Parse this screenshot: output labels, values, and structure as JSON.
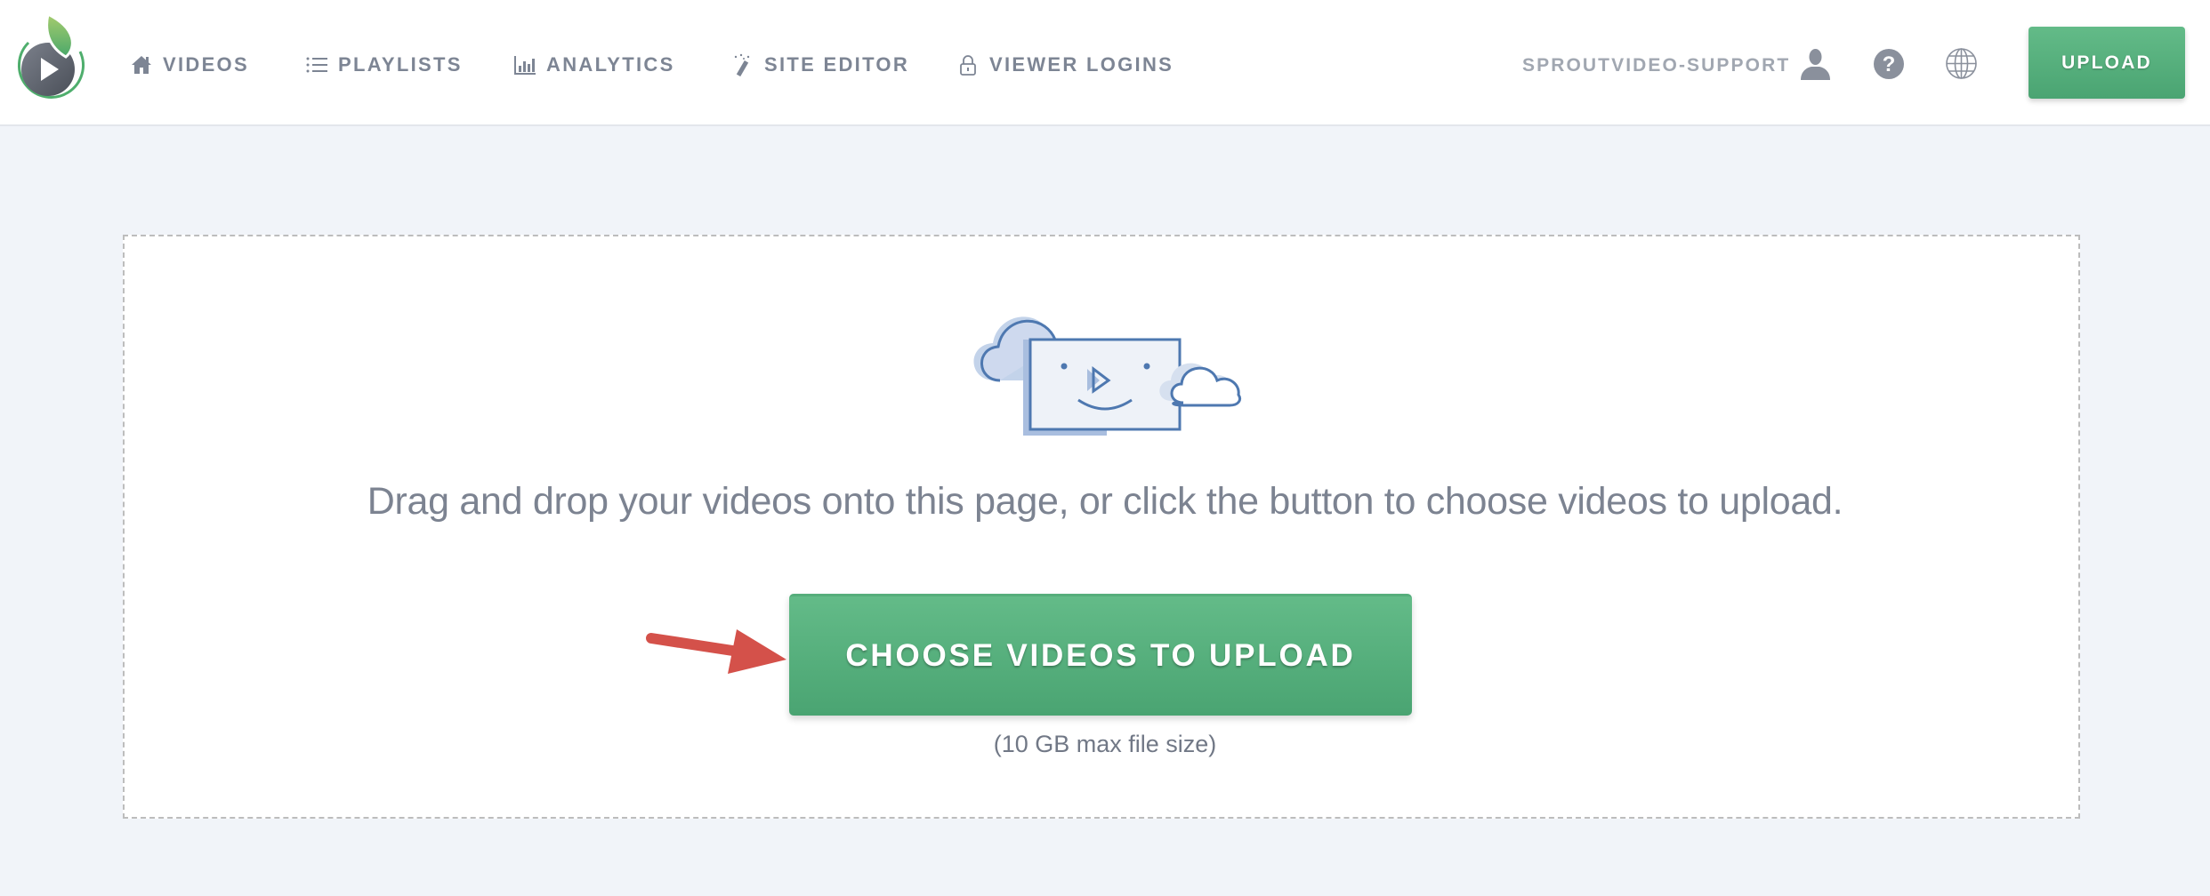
{
  "app": {
    "name": "SproutVideo"
  },
  "header": {
    "nav": [
      {
        "id": "videos",
        "label": "VIDEOS",
        "icon": "home-icon"
      },
      {
        "id": "playlists",
        "label": "PLAYLISTS",
        "icon": "list-icon"
      },
      {
        "id": "analytics",
        "label": "ANALYTICS",
        "icon": "bar-chart-icon"
      },
      {
        "id": "site-editor",
        "label": "SITE EDITOR",
        "icon": "magic-wand-icon"
      },
      {
        "id": "viewer-logins",
        "label": "VIEWER LOGINS",
        "icon": "lock-icon"
      }
    ],
    "username": "SPROUTVIDEO-SUPPORT",
    "icons": {
      "user": "user-icon",
      "help": "question-circle-icon",
      "language": "globe-icon"
    },
    "upload_label": "UPLOAD"
  },
  "dropzone": {
    "illustration": "cloud-video-illustration",
    "instructions": "Drag and drop your videos onto this page, or click the button to choose videos to upload.",
    "choose_button_label": "CHOOSE VIDEOS TO UPLOAD",
    "max_size_note": "(10 GB max file size)",
    "annotation": "red-arrow-pointing-to-button"
  },
  "colors": {
    "brand_green": "#5cb583",
    "nav_text": "#7d8594",
    "background": "#f1f4f9",
    "illustration_blue": "#4e78b0",
    "annotation_red": "#d4514a"
  }
}
